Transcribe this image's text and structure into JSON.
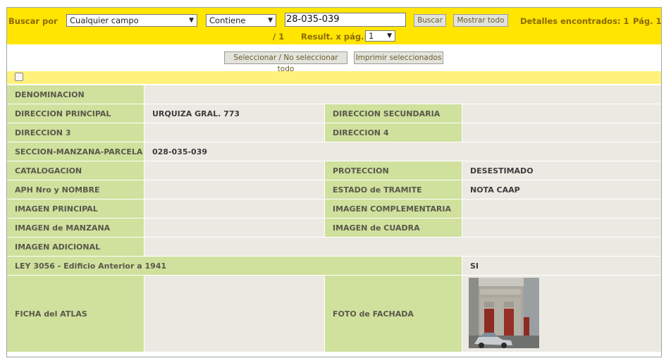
{
  "search": {
    "label": "Buscar por",
    "field_select": "Cualquier campo",
    "operator_select": "Contiene",
    "query": "28-035-039",
    "search_button": "Buscar",
    "show_all_button": "Mostrar todo",
    "found_text": "Detalles encontrados: 1",
    "page_text": "Pág. 1",
    "page_total": "/ 1",
    "per_page_label": "Result. x pág.:",
    "per_page_value": "1"
  },
  "actions": {
    "select_all_button": "Seleccionar / No seleccionar todo",
    "print_selected_button": "Imprimir seleccionados"
  },
  "record": {
    "denominacion": {
      "label": "DENOMINACION",
      "value": ""
    },
    "direccion_principal": {
      "label": "DIRECCION PRINCIPAL",
      "value": "URQUIZA GRAL. 773"
    },
    "direccion_secundaria": {
      "label": "DIRECCION SECUNDARIA",
      "value": ""
    },
    "direccion_3": {
      "label": "DIRECCION 3",
      "value": ""
    },
    "direccion_4": {
      "label": "DIRECCION 4",
      "value": ""
    },
    "seccion": {
      "label": "SECCION-MANZANA-PARCELA",
      "value": "028-035-039"
    },
    "catalogacion": {
      "label": "CATALOGACION",
      "value": ""
    },
    "proteccion": {
      "label": "PROTECCION",
      "value": "DESESTIMADO"
    },
    "aph": {
      "label": "APH Nro y NOMBRE",
      "value": ""
    },
    "estado_tramite": {
      "label": "ESTADO de TRAMITE",
      "value": "NOTA CAAP"
    },
    "imagen_principal": {
      "label": "IMAGEN PRINCIPAL",
      "value": ""
    },
    "imagen_complementaria": {
      "label": "IMAGEN COMPLEMENTARIA",
      "value": ""
    },
    "imagen_manzana": {
      "label": "IMAGEN de MANZANA",
      "value": ""
    },
    "imagen_cuadra": {
      "label": "IMAGEN de CUADRA",
      "value": ""
    },
    "imagen_adicional": {
      "label": "IMAGEN ADICIONAL",
      "value": ""
    },
    "ley_3056": {
      "label": "LEY 3056 - Edificio Anterior a 1941",
      "value": "SI"
    },
    "ficha_atlas": {
      "label": "FICHA del ATLAS",
      "value": ""
    },
    "foto_fachada": {
      "label": "FOTO de FACHADA"
    }
  },
  "colors": {
    "search_bar": "#ffe500",
    "label_cell": "#cfe19d",
    "value_cell": "#ece9e3",
    "header_band": "#fff17a"
  }
}
